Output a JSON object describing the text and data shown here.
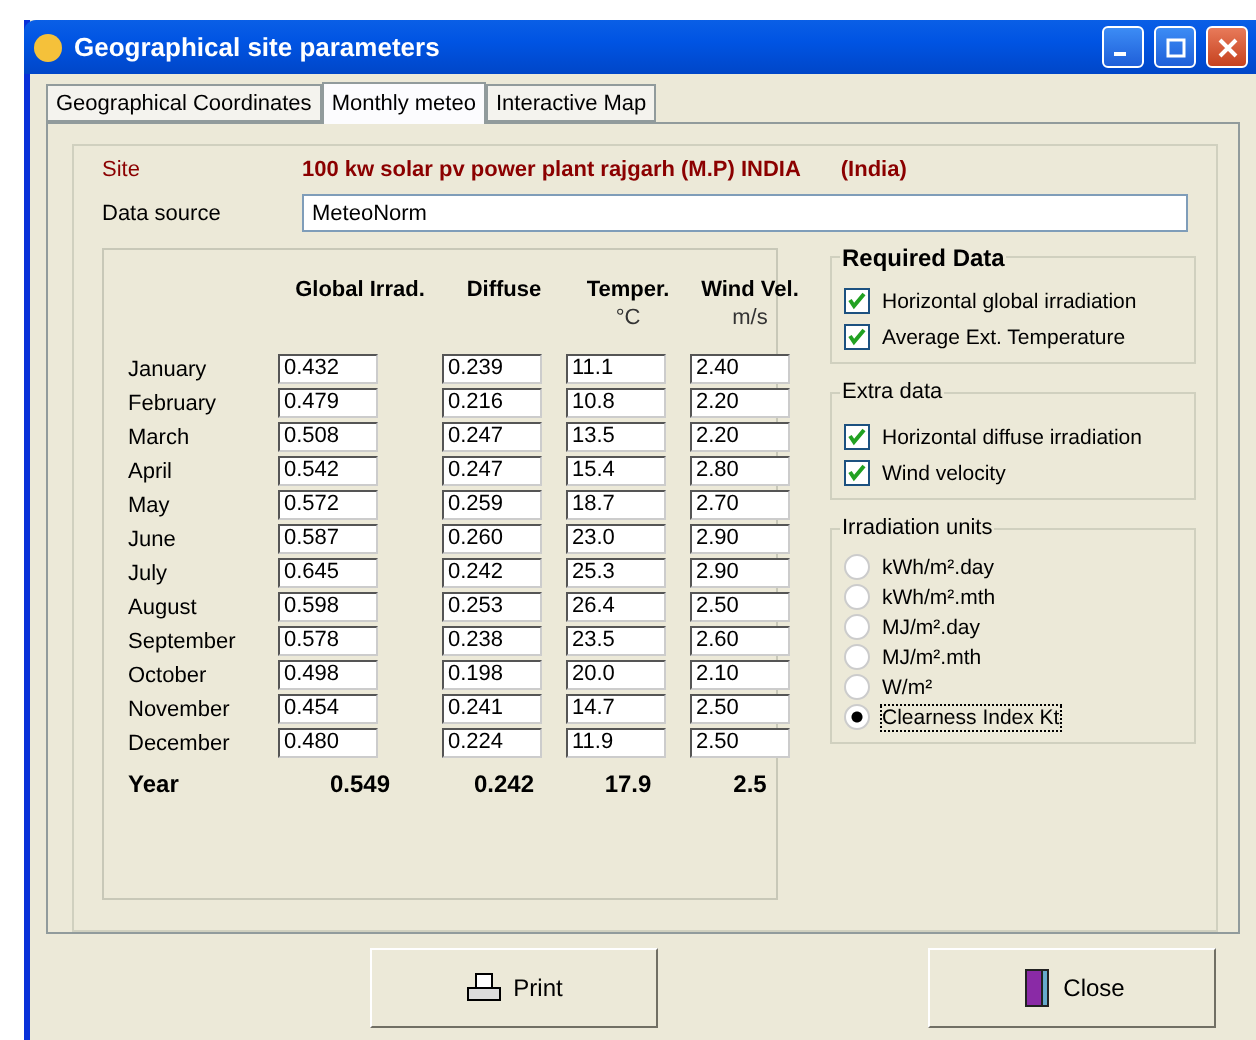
{
  "window": {
    "title": "Geographical site parameters"
  },
  "tabs": [
    {
      "label": "Geographical Coordinates",
      "selected": false
    },
    {
      "label": "Monthly meteo",
      "selected": true
    },
    {
      "label": "Interactive Map",
      "selected": false
    }
  ],
  "site": {
    "label": "Site",
    "value": "100 kw solar pv power plant rajgarh (M.P) INDIA",
    "country": "(India)"
  },
  "data_source": {
    "label": "Data source",
    "value": "MeteoNorm"
  },
  "table": {
    "columns": [
      {
        "title": "Global Irrad."
      },
      {
        "title": "Diffuse"
      },
      {
        "title": "Temper.",
        "unit": "°C"
      },
      {
        "title": "Wind Vel.",
        "unit": "m/s"
      }
    ],
    "rows": [
      {
        "month": "January",
        "values": [
          "0.432",
          "0.239",
          "11.1",
          "2.40"
        ]
      },
      {
        "month": "February",
        "values": [
          "0.479",
          "0.216",
          "10.8",
          "2.20"
        ]
      },
      {
        "month": "March",
        "values": [
          "0.508",
          "0.247",
          "13.5",
          "2.20"
        ]
      },
      {
        "month": "April",
        "values": [
          "0.542",
          "0.247",
          "15.4",
          "2.80"
        ]
      },
      {
        "month": "May",
        "values": [
          "0.572",
          "0.259",
          "18.7",
          "2.70"
        ]
      },
      {
        "month": "June",
        "values": [
          "0.587",
          "0.260",
          "23.0",
          "2.90"
        ]
      },
      {
        "month": "July",
        "values": [
          "0.645",
          "0.242",
          "25.3",
          "2.90"
        ]
      },
      {
        "month": "August",
        "values": [
          "0.598",
          "0.253",
          "26.4",
          "2.50"
        ]
      },
      {
        "month": "September",
        "values": [
          "0.578",
          "0.238",
          "23.5",
          "2.60"
        ]
      },
      {
        "month": "October",
        "values": [
          "0.498",
          "0.198",
          "20.0",
          "2.10"
        ]
      },
      {
        "month": "November",
        "values": [
          "0.454",
          "0.241",
          "14.7",
          "2.50"
        ]
      },
      {
        "month": "December",
        "values": [
          "0.480",
          "0.224",
          "11.9",
          "2.50"
        ]
      }
    ],
    "total": {
      "label": "Year",
      "values": [
        "0.549",
        "0.242",
        "17.9",
        "2.5"
      ]
    }
  },
  "required_data": {
    "title": "Required Data",
    "items": [
      {
        "label": "Horizontal global irradiation",
        "checked": true
      },
      {
        "label": "Average Ext. Temperature",
        "checked": true
      }
    ]
  },
  "extra_data": {
    "title": "Extra data",
    "items": [
      {
        "label": "Horizontal diffuse irradiation",
        "checked": true
      },
      {
        "label": "Wind velocity",
        "checked": true
      }
    ]
  },
  "irradiation_units": {
    "title": "Irradiation units",
    "options": [
      {
        "label": "kWh/m².day",
        "selected": false
      },
      {
        "label": "kWh/m².mth",
        "selected": false
      },
      {
        "label": "MJ/m².day",
        "selected": false
      },
      {
        "label": "MJ/m².mth",
        "selected": false
      },
      {
        "label": "W/m²",
        "selected": false
      },
      {
        "label": "Clearness Index Kt",
        "selected": true
      }
    ]
  },
  "buttons": [
    {
      "kind": "print",
      "label": "Print"
    },
    {
      "kind": "close",
      "label": "Close"
    }
  ]
}
